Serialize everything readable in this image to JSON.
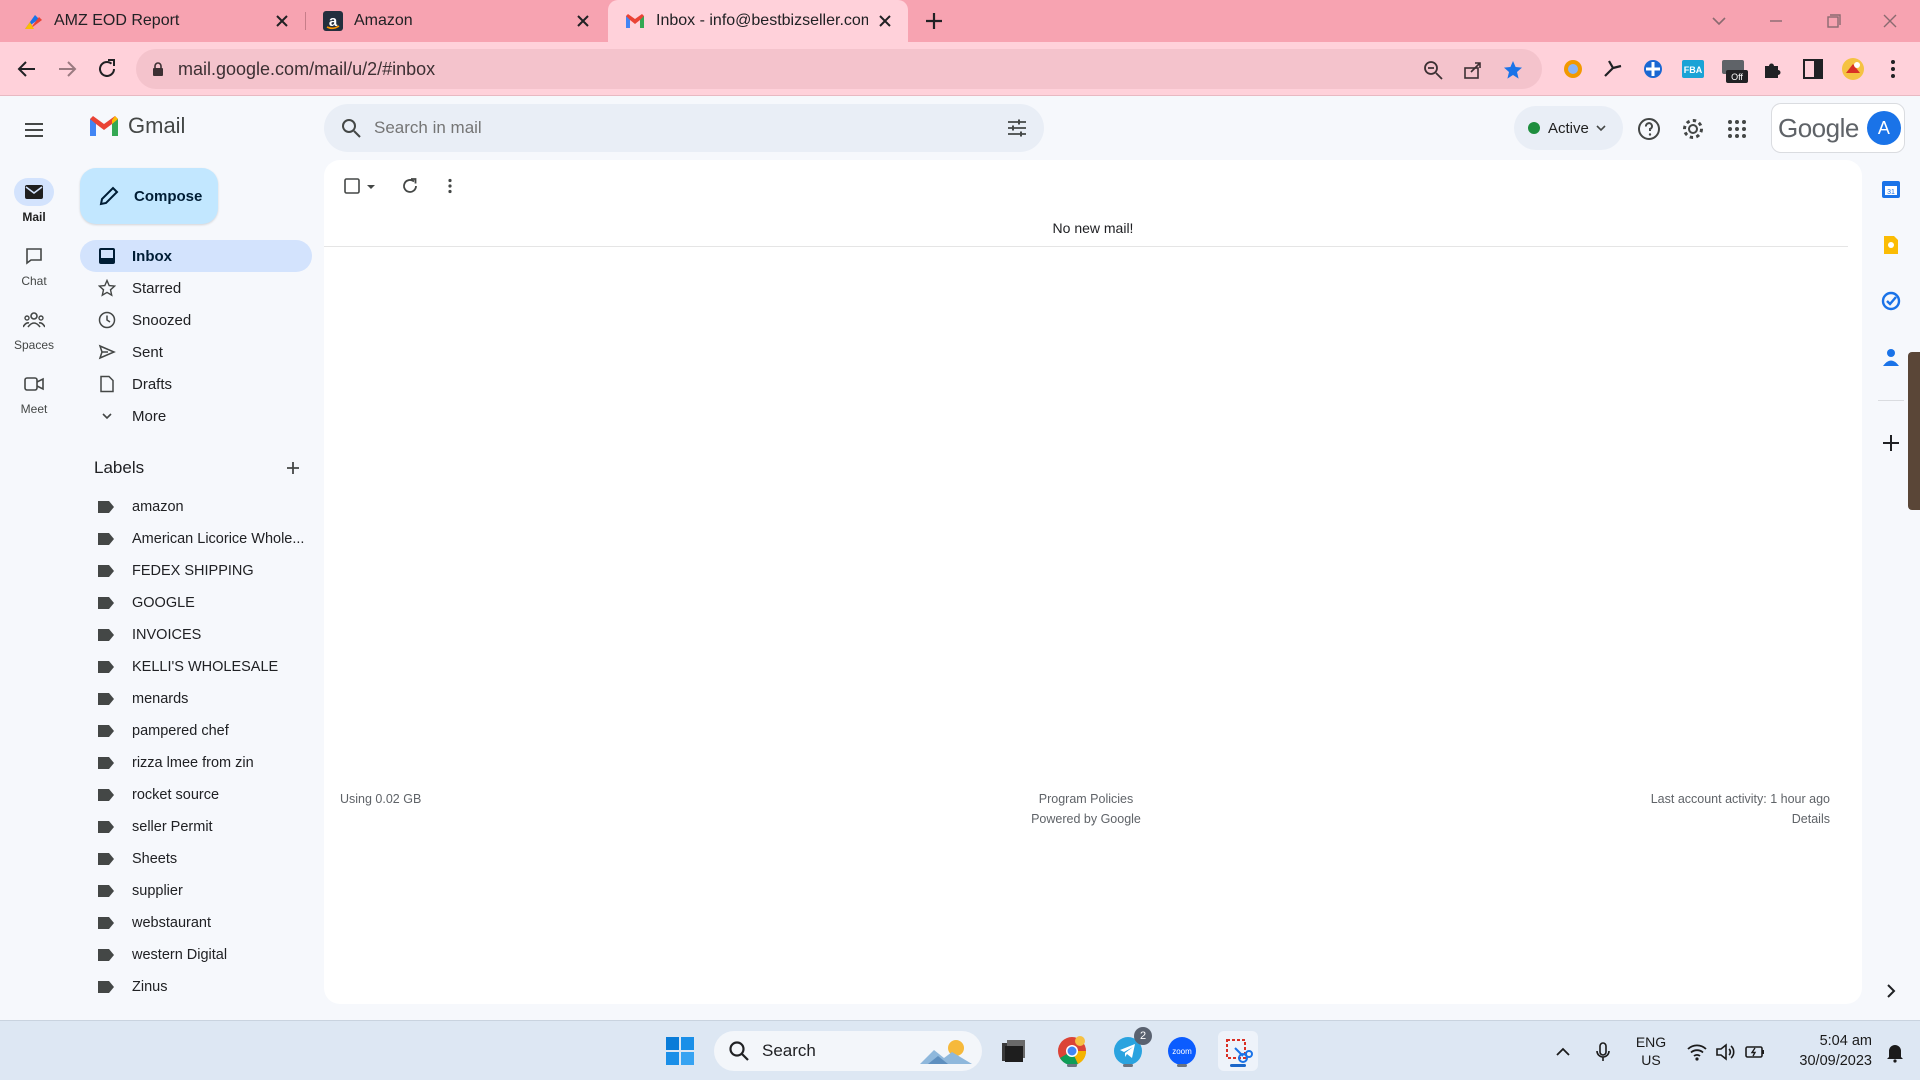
{
  "browser": {
    "tabs": [
      {
        "title": "AMZ EOD Report",
        "icon": "amz-eod-favicon-icon"
      },
      {
        "title": "Amazon",
        "icon": "amazon-favicon-icon"
      },
      {
        "title": "Inbox - info@bestbizseller.com -",
        "icon": "gmail-favicon-icon",
        "active": true
      }
    ],
    "url": "mail.google.com/mail/u/2/#inbox",
    "accent_color": "#f7a3b1",
    "extensions": [
      "extension-orange-icon",
      "extension-arrow-icon",
      "extension-blue-icon",
      "extension-fba-icon",
      "extension-off-icon",
      "puzzle-icon",
      "sidepanel-icon",
      "profile-icon",
      "menu-dots-icon"
    ],
    "ext_badges": {
      "fba": "FBA",
      "off": "Off"
    }
  },
  "gmail": {
    "app_name": "Gmail",
    "search_placeholder": "Search in mail",
    "status": "Active",
    "brand_word": "Google",
    "avatar_letter": "A",
    "rail": [
      {
        "label": "Mail",
        "icon": "mail-icon",
        "active": true
      },
      {
        "label": "Chat",
        "icon": "chat-icon"
      },
      {
        "label": "Spaces",
        "icon": "spaces-icon"
      },
      {
        "label": "Meet",
        "icon": "meet-icon"
      }
    ],
    "compose_label": "Compose",
    "nav": [
      {
        "label": "Inbox",
        "icon": "inbox-icon",
        "active": true
      },
      {
        "label": "Starred",
        "icon": "star-icon"
      },
      {
        "label": "Snoozed",
        "icon": "clock-icon"
      },
      {
        "label": "Sent",
        "icon": "send-icon"
      },
      {
        "label": "Drafts",
        "icon": "draft-icon"
      },
      {
        "label": "More",
        "icon": "chevron-down-icon"
      }
    ],
    "labels_heading": "Labels",
    "labels": [
      "amazon",
      "American Licorice Whole...",
      "FEDEX SHIPPING",
      "GOOGLE",
      "INVOICES",
      "KELLI'S WHOLESALE",
      "menards",
      "pampered chef",
      "rizza lmee from zin",
      "rocket source",
      "seller Permit",
      "Sheets",
      "supplier",
      "webstaurant",
      "western Digital",
      "Zinus"
    ],
    "empty_message": "No new mail!",
    "footer": {
      "storage": "Using 0.02 GB",
      "policies": "Program Policies",
      "powered": "Powered by Google",
      "activity": "Last account activity: 1 hour ago",
      "details": "Details"
    }
  },
  "taskbar": {
    "search_label": "Search",
    "telegram_badge": "2",
    "zoom_label": "zoom",
    "lang_top": "ENG",
    "lang_bottom": "US",
    "time": "5:04 am",
    "date": "30/09/2023"
  }
}
